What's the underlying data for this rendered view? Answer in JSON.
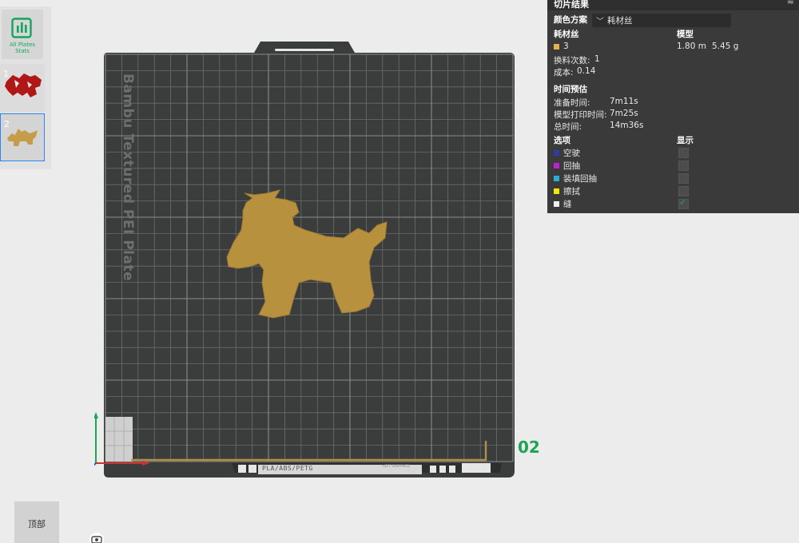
{
  "plate_list": {
    "stats_label": "All Plates Stats",
    "plates": [
      {
        "number": "1",
        "selected": false
      },
      {
        "number": "2",
        "selected": true
      }
    ]
  },
  "build_plate": {
    "name": "Bambu Textured PEI Plate",
    "plate_number": "02",
    "bottom_strip_text": "PLA/ABS/PETG",
    "hot_surface_text": "HOT SURFACE",
    "model_color": "#b8913f"
  },
  "panel": {
    "title": "切片结果",
    "collapse_icon": "double-chevron-up-icon",
    "color_scheme_label": "颜色方案",
    "color_scheme_value": "耗材丝",
    "filament_header": "耗材丝",
    "model_header": "模型",
    "filament": {
      "id": "3",
      "color": "#e8b04a",
      "length": "1.80 m",
      "weight": "5.45 g"
    },
    "change_count_label": "换料次数:",
    "change_count_value": "1",
    "cost_label": "成本:",
    "cost_value": "0.14",
    "time_header": "时间预估",
    "prep_time_label": "准备时间:",
    "prep_time_value": "7m11s",
    "print_time_label": "模型打印时间:",
    "print_time_value": "7m25s",
    "total_time_label": "总时间:",
    "total_time_value": "14m36s",
    "options_header": "选项",
    "display_header": "显示",
    "options": [
      {
        "label": "空驶",
        "color": "#2d3ea0",
        "checked": false
      },
      {
        "label": "回抽",
        "color": "#c21fd0",
        "checked": false
      },
      {
        "label": "装填回抽",
        "color": "#2ab0cc",
        "checked": false
      },
      {
        "label": "擦拭",
        "color": "#f0e800",
        "checked": false
      },
      {
        "label": "缝",
        "color": "#eeeeee",
        "checked": true
      }
    ]
  },
  "view": {
    "top_view_label": "顶部"
  }
}
